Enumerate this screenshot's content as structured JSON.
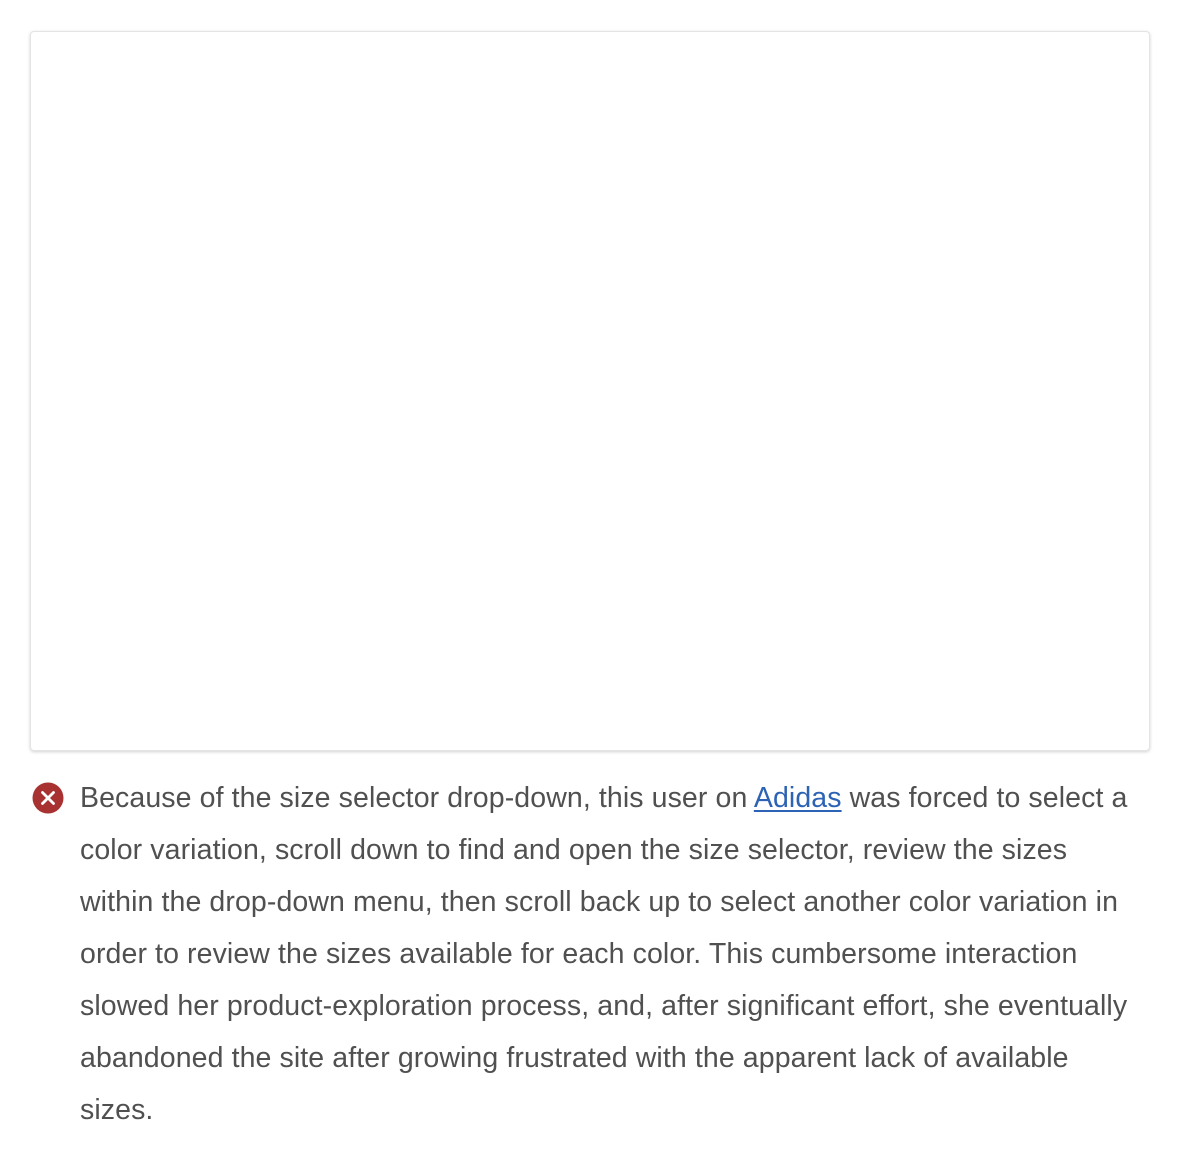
{
  "caption": {
    "status_icon": "error-x-icon",
    "status_color": "#a83232",
    "text_before_link": "Because of the size selector drop-down, this user on ",
    "link_text": "Adidas",
    "text_after_link": " was forced to select a color variation, scroll down to find and open the size selector, review the sizes within the drop-down menu, then scroll back up to select another color variation in order to review the sizes available for each color. This cumbersome interaction slowed her product-exploration process, and, after significant effort, she eventually abandoned the site after growing frustrated with the apparent lack of available sizes."
  },
  "colors": {
    "text": "#505050",
    "link": "#2d63b4",
    "error_icon": "#a83232"
  }
}
